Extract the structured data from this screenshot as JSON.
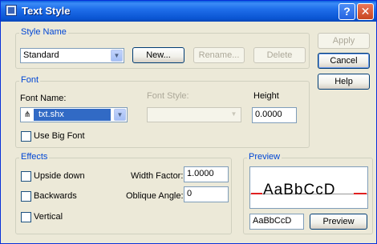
{
  "window": {
    "title": "Text Style",
    "help_glyph": "?",
    "close_glyph": "✕"
  },
  "style_name": {
    "legend": "Style Name",
    "selected": "Standard",
    "new_label": "New...",
    "rename_label": "Rename...",
    "delete_label": "Delete"
  },
  "buttons": {
    "apply": "Apply",
    "cancel": "Cancel",
    "help": "Help"
  },
  "font": {
    "legend": "Font",
    "font_name_label": "Font Name:",
    "font_name_value": "txt.shx",
    "font_style_label": "Font Style:",
    "height_label": "Height",
    "height_value": "0.0000",
    "use_big_font_label": "Use Big Font"
  },
  "effects": {
    "legend": "Effects",
    "upside_down_label": "Upside down",
    "backwards_label": "Backwards",
    "vertical_label": "Vertical",
    "width_factor_label": "Width Factor:",
    "width_factor_value": "1.0000",
    "oblique_angle_label": "Oblique Angle:",
    "oblique_angle_value": "0"
  },
  "preview": {
    "legend": "Preview",
    "sample_text": "AaBbCcD",
    "input_value": "AaBbCcD",
    "preview_button": "Preview"
  },
  "icons": {
    "app": "text-style-app-icon",
    "dropdown": "chevron-down-icon",
    "font_type": "shx-font-icon"
  }
}
